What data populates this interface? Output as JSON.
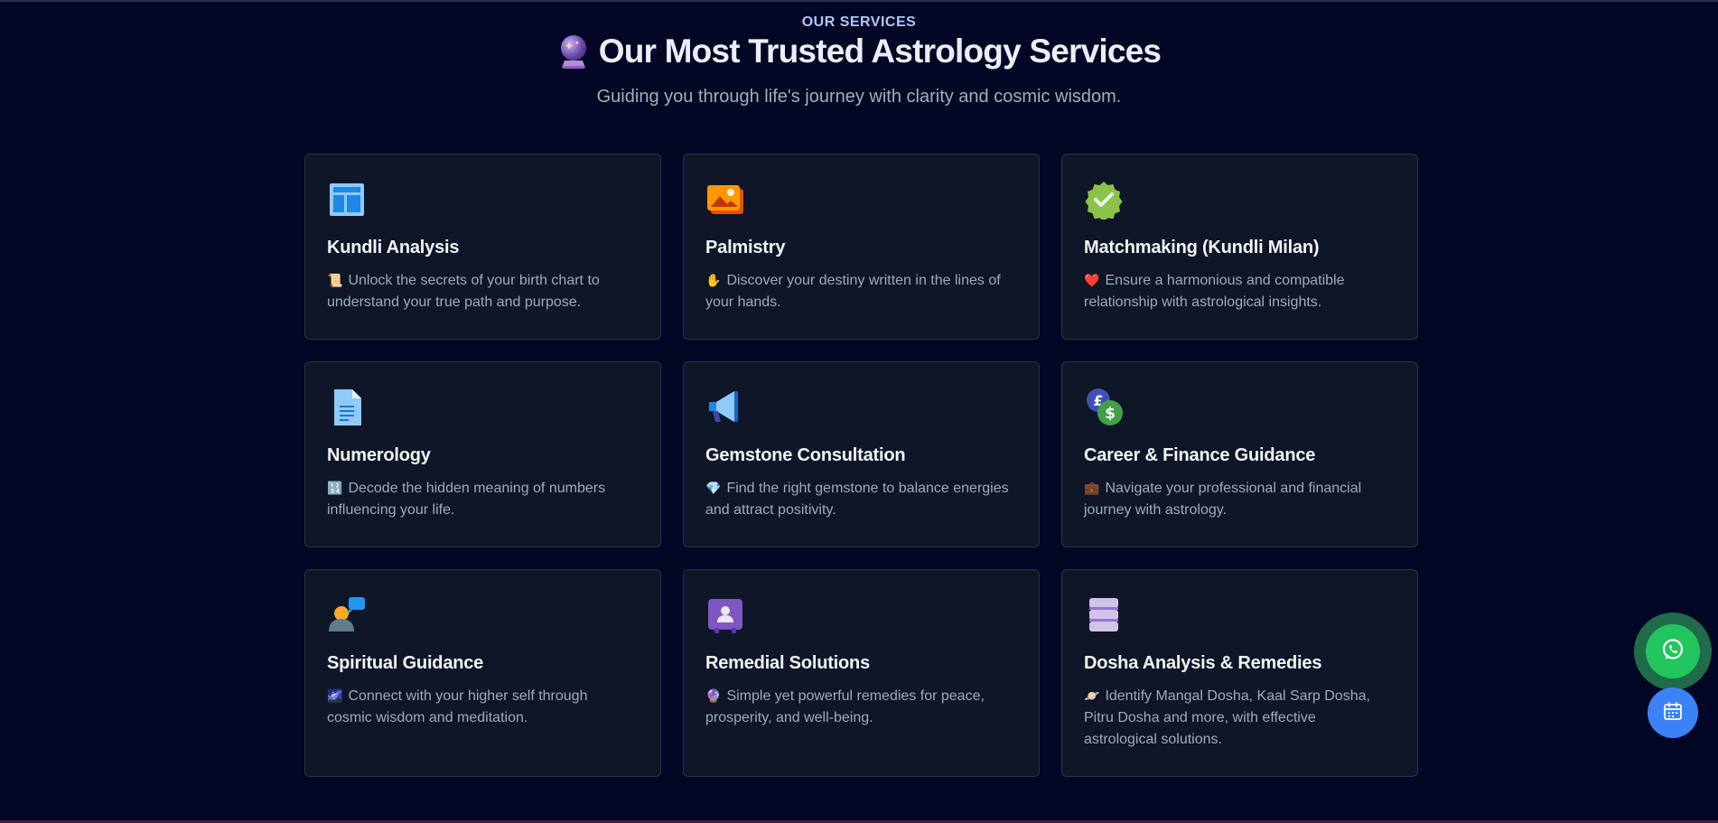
{
  "section": {
    "eyebrow": "OUR SERVICES",
    "title": "Our Most Trusted Astrology Services",
    "subtitle": "Guiding you through life's journey with clarity and cosmic wisdom."
  },
  "services": [
    {
      "title": "Kundli Analysis",
      "emoji": "📜",
      "description": "Unlock the secrets of your birth chart to understand your true path and purpose.",
      "icon": "layout-icon"
    },
    {
      "title": "Palmistry",
      "emoji": "✋",
      "description": "Discover your destiny written in the lines of your hands.",
      "icon": "image-icon"
    },
    {
      "title": "Matchmaking (Kundli Milan)",
      "emoji": "❤️",
      "description": "Ensure a harmonious and compatible relationship with astrological insights.",
      "icon": "verified-badge-icon"
    },
    {
      "title": "Numerology",
      "emoji": "🔢",
      "description": "Decode the hidden meaning of numbers influencing your life.",
      "icon": "document-icon"
    },
    {
      "title": "Gemstone Consultation",
      "emoji": "💎",
      "description": "Find the right gemstone to balance energies and attract positivity.",
      "icon": "megaphone-icon"
    },
    {
      "title": "Career & Finance Guidance",
      "emoji": "💼",
      "description": "Navigate your professional and financial journey with astrology.",
      "icon": "currency-exchange-icon"
    },
    {
      "title": "Spiritual Guidance",
      "emoji": "🌌",
      "description": "Connect with your higher self through cosmic wisdom and meditation.",
      "icon": "person-chat-icon"
    },
    {
      "title": "Remedial Solutions",
      "emoji": "🔮",
      "description": "Simple yet powerful remedies for peace, prosperity, and well-being.",
      "icon": "contact-card-icon"
    },
    {
      "title": "Dosha Analysis & Remedies",
      "emoji": "🪐",
      "description": "Identify Mangal Dosha, Kaal Sarp Dosha, Pitru Dosha and more, with effective astrological solutions.",
      "icon": "stack-icon"
    }
  ],
  "floating": {
    "whatsapp_icon": "whatsapp-icon",
    "calendar_icon": "calendar-icon"
  },
  "colors": {
    "background": "#030624",
    "card": "#0f1627",
    "card_border": "#2a3346",
    "accent_eyebrow": "#aec7f5",
    "whatsapp": "#22c55e",
    "calendar": "#3b82f6"
  }
}
